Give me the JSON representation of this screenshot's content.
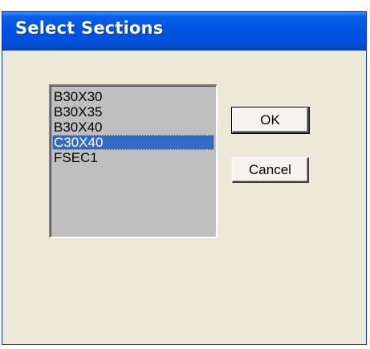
{
  "window": {
    "title": "Select Sections"
  },
  "sections_list": {
    "items": [
      {
        "label": "B30X30",
        "selected": false
      },
      {
        "label": "B30X35",
        "selected": false
      },
      {
        "label": "B30X40",
        "selected": false
      },
      {
        "label": "C30X40",
        "selected": true
      },
      {
        "label": "FSEC1",
        "selected": false
      }
    ]
  },
  "buttons": {
    "ok_label": "OK",
    "cancel_label": "Cancel"
  },
  "colors": {
    "title_bar": "#0054e3",
    "selection": "#316ac5",
    "list_background": "#bfbfbf",
    "dialog_background": "#ece9d8"
  }
}
